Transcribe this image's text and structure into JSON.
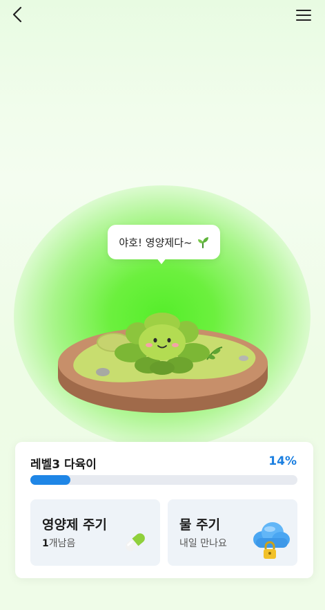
{
  "header": {
    "back_icon": "chevron-left-icon",
    "menu_icon": "hamburger-menu-icon"
  },
  "bubble": {
    "text": "야호! 영양제다~",
    "icon": "sprout-icon"
  },
  "plant": {
    "level_title": "레벨3 다육이",
    "progress_text": "14%",
    "progress_value": 0.14
  },
  "actions": {
    "nutrient": {
      "title": "영양제 주기",
      "count": "1",
      "count_suffix": "개남음",
      "icon": "pill-icon"
    },
    "water": {
      "title": "물 주기",
      "subtitle": "내일 만나요",
      "icon": "locked-cloud-icon"
    }
  },
  "colors": {
    "accent": "#1f86e6",
    "percent_text": "#1b7fe0",
    "glow": "#55ee2a",
    "track": "#e7eaf0"
  }
}
